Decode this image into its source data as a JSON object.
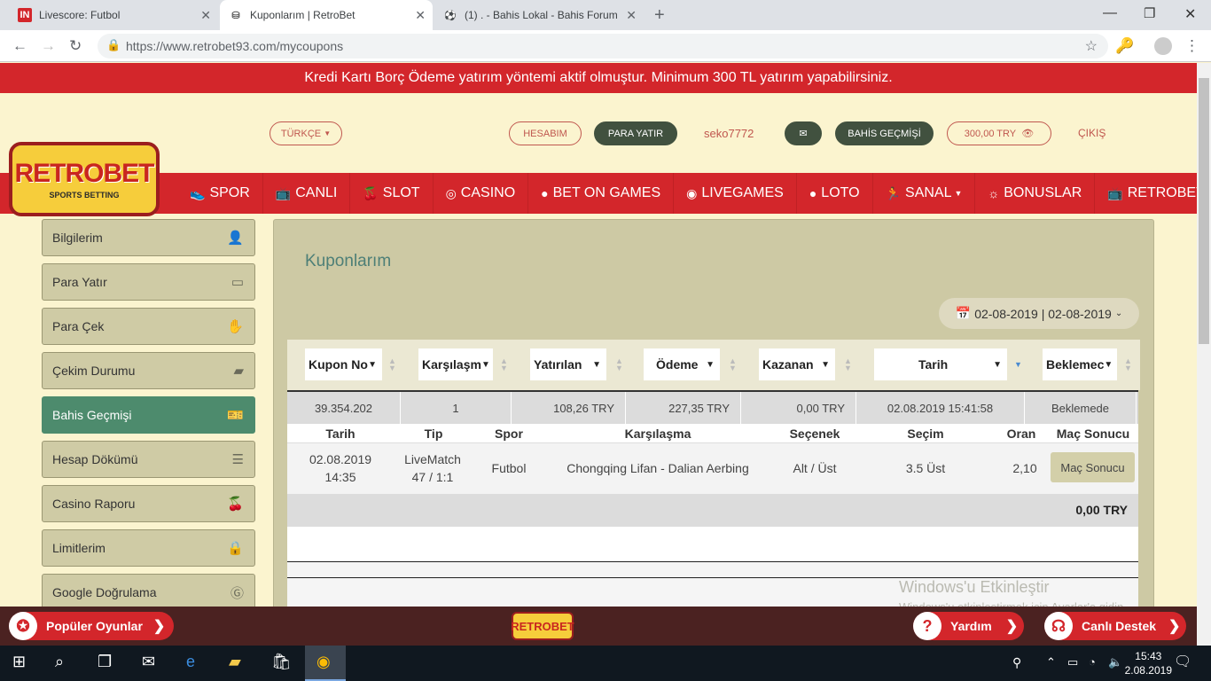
{
  "browser": {
    "tabs": [
      {
        "title": "Livescore: Futbol",
        "icon": "livescore-icon"
      },
      {
        "title": "Kuponlarım | RetroBet",
        "icon": "retrobet-icon"
      },
      {
        "title": "(1) . - Bahis Lokal - Bahis Forum",
        "icon": "soccer-ball-icon"
      }
    ],
    "url": "https://www.retrobet93.com/mycoupons"
  },
  "site": {
    "banner": "Kredi Kartı Borç Ödeme yatırım yöntemi aktif olmuştur. Minimum 300 TL yatırım yapabilirsiniz.",
    "logo_text": "RETROBET",
    "logo_sub": "SPORTS BETTING",
    "language": "TÜRKÇE",
    "account_btn": "HESABIM",
    "deposit_btn": "PARA YATIR",
    "username": "seko7772",
    "history_btn": "BAHİS GEÇMİŞİ",
    "balance": "300,00 TRY",
    "logout": "ÇIKIŞ",
    "menu": [
      {
        "label": "SPOR",
        "icon": "shoe-icon"
      },
      {
        "label": "CANLI",
        "icon": "tv-icon"
      },
      {
        "label": "SLOT",
        "icon": "cherry-icon"
      },
      {
        "label": "CASINO",
        "icon": "chip-icon"
      },
      {
        "label": "BET ON GAMES",
        "icon": "globe-icon"
      },
      {
        "label": "LIVEGAMES",
        "icon": "target-icon"
      },
      {
        "label": "LOTO",
        "icon": "lotto-icon"
      },
      {
        "label": "SANAL",
        "icon": "runner-icon"
      },
      {
        "label": "BONUSLAR",
        "icon": "bulb-icon"
      },
      {
        "label": "RETROBETTV",
        "icon": "tv-icon"
      }
    ]
  },
  "sidebar": {
    "items": [
      {
        "label": "Bilgilerim",
        "icon": "user-icon"
      },
      {
        "label": "Para Yatır",
        "icon": "wallet-icon"
      },
      {
        "label": "Para Çek",
        "icon": "hand-coin-icon"
      },
      {
        "label": "Çekim Durumu",
        "icon": "cash-icon"
      },
      {
        "label": "Bahis Geçmişi",
        "icon": "ticket-icon"
      },
      {
        "label": "Hesap Dökümü",
        "icon": "list-icon"
      },
      {
        "label": "Casino Raporu",
        "icon": "cherry-icon"
      },
      {
        "label": "Limitlerim",
        "icon": "lock-icon"
      },
      {
        "label": "Google Doğrulama",
        "icon": "google-icon"
      }
    ]
  },
  "main": {
    "title": "Kuponlarım",
    "date_range": "02-08-2019 | 02-08-2019",
    "filters": [
      "Kupon No",
      "Karşılaşm",
      "Yatırılan",
      "Ödeme",
      "Kazanan",
      "Tarih",
      "Beklemec"
    ],
    "coupon": {
      "no": "39.354.202",
      "matches": "1",
      "stake": "108,26 TRY",
      "payout": "227,35 TRY",
      "won": "0,00 TRY",
      "date": "02.08.2019 15:41:58",
      "status": "Beklemede"
    },
    "detail_headers": [
      "Tarih",
      "Tip",
      "Spor",
      "Karşılaşma",
      "Seçenek",
      "Seçim",
      "Oran",
      "Maç Sonucu"
    ],
    "detail_row": {
      "date1": "02.08.2019",
      "date2": "14:35",
      "type1": "LiveMatch",
      "type2": "47 / 1:1",
      "sport": "Futbol",
      "match": "Chongqing Lifan - Dalian Aerbing",
      "option": "Alt / Üst",
      "choice": "3.5 Üst",
      "odds": "2,10",
      "result_btn": "Maç Sonucu"
    },
    "total": "0,00 TRY"
  },
  "bottom": {
    "popular": "Popüler Oyunlar",
    "help": "Yardım",
    "support": "Canlı Destek",
    "mini_logo": "RETROBET"
  },
  "watermark": {
    "line1": "Windows'u Etkinleştir",
    "line2": "Windows'u etkinleştirmek için Ayarlar'a gidin."
  },
  "taskbar": {
    "time": "15:43",
    "date": "2.08.2019"
  }
}
